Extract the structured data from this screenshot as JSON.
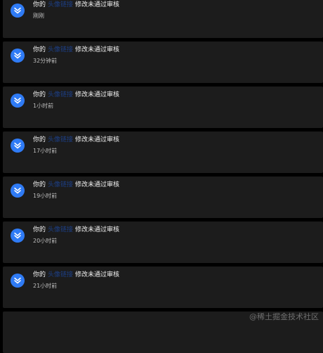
{
  "notifications": [
    {
      "prefix": "你的",
      "link": "头像链接",
      "suffix": "修改未通过审核",
      "time": "刚刚"
    },
    {
      "prefix": "你的",
      "link": "头像链接",
      "suffix": "修改未通过审核",
      "time": "32分钟前"
    },
    {
      "prefix": "你的",
      "link": "头像链接",
      "suffix": "修改未通过审核",
      "time": "1小时前"
    },
    {
      "prefix": "你的",
      "link": "头像链接",
      "suffix": "修改未通过审核",
      "time": "17小时前"
    },
    {
      "prefix": "你的",
      "link": "头像链接",
      "suffix": "修改未通过审核",
      "time": "19小时前"
    },
    {
      "prefix": "你的",
      "link": "头像链接",
      "suffix": "修改未通过审核",
      "time": "20小时前"
    },
    {
      "prefix": "你的",
      "link": "头像链接",
      "suffix": "修改未通过审核",
      "time": "21小时前"
    },
    {
      "prefix": "",
      "link": "",
      "suffix": "",
      "time": ""
    }
  ],
  "icon": "juejin-logo-icon",
  "colors": {
    "background": "#000000",
    "card": "#1c1c1c",
    "avatar": "#2f7bf5",
    "link": "#1c3f86",
    "title": "#f2f2f2",
    "time": "#bdbdbd"
  },
  "watermark": "@稀土掘金技术社区"
}
